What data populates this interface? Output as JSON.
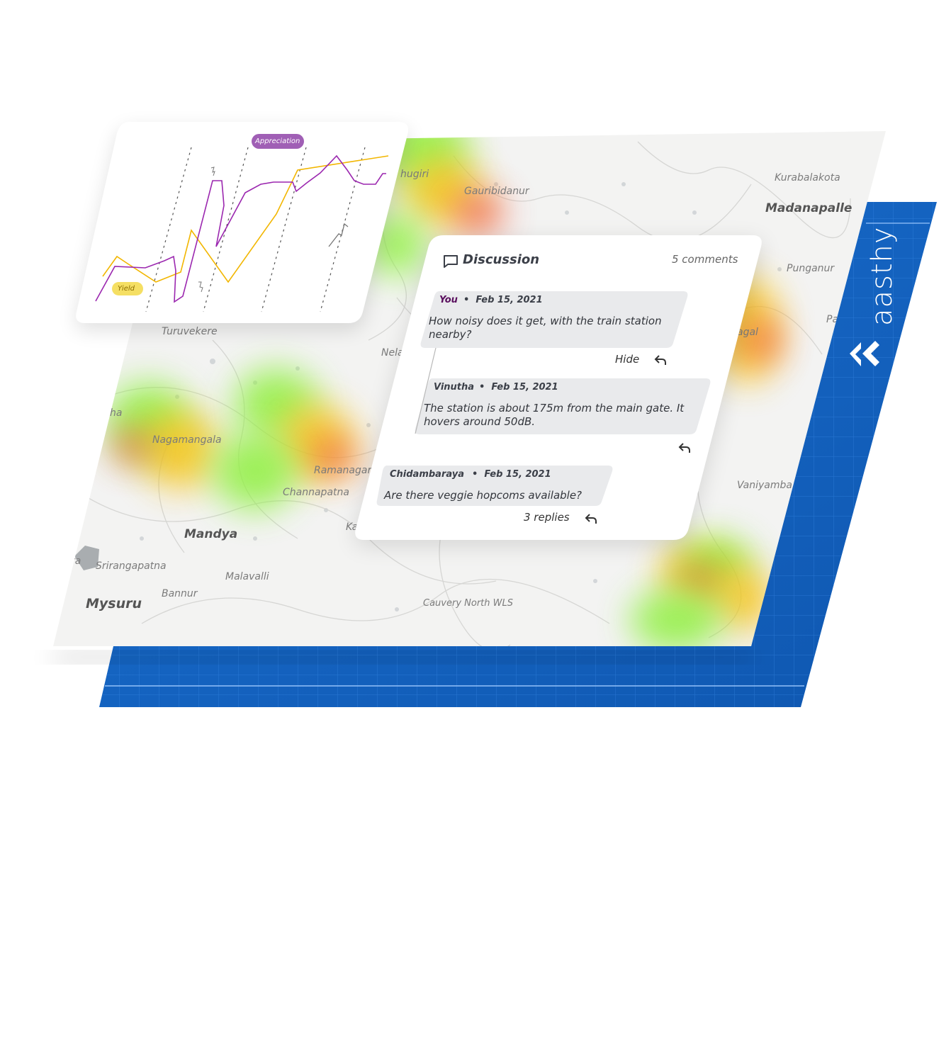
{
  "brand": {
    "name": "aasthy"
  },
  "map": {
    "labels": [
      {
        "text": "Gauribidanur",
        "cls": ""
      },
      {
        "text": "Kurabalakota",
        "cls": ""
      },
      {
        "text": "Madanapalle",
        "cls": "big"
      },
      {
        "text": "Punganur",
        "cls": ""
      },
      {
        "text": "Pa",
        "cls": ""
      },
      {
        "text": "agal",
        "cls": ""
      },
      {
        "text": "Turuvekere",
        "cls": ""
      },
      {
        "text": "Nela",
        "cls": ""
      },
      {
        "text": "Nagamangala",
        "cls": ""
      },
      {
        "text": "Ramanagar",
        "cls": ""
      },
      {
        "text": "Channapatna",
        "cls": ""
      },
      {
        "text": "Mandya",
        "cls": "big"
      },
      {
        "text": "Srirangapatna",
        "cls": ""
      },
      {
        "text": "Malavalli",
        "cls": ""
      },
      {
        "text": "Bannur",
        "cls": ""
      },
      {
        "text": "Mysuru",
        "cls": "big"
      },
      {
        "text": "Cauvery North WLS",
        "cls": ""
      },
      {
        "text": "Vaniyamba",
        "cls": ""
      },
      {
        "text": "hugiri",
        "cls": ""
      },
      {
        "text": "ha",
        "cls": ""
      },
      {
        "text": "ra",
        "cls": ""
      },
      {
        "text": "Ka",
        "cls": ""
      }
    ]
  },
  "chart_data": {
    "type": "line",
    "series": [
      {
        "name": "Appreciation",
        "color": "#9b27af"
      },
      {
        "name": "Yield",
        "color": "#f2b600"
      }
    ],
    "legend_tags": {
      "appreciation": "Appreciation",
      "yield": "Yield"
    }
  },
  "discussion": {
    "title": "Discussion",
    "count": "5 comments",
    "comments": [
      {
        "author": "You",
        "date": "Feb 15, 2021",
        "body": "How noisy does it get, with the train station nearby?",
        "action": "Hide"
      },
      {
        "author": "Vinutha",
        "date": "Feb 15, 2021",
        "body": "The station is about 175m from the main gate. It hovers around 50dB.",
        "action": ""
      },
      {
        "author": "Chidambaraya",
        "date": "Feb 15, 2021",
        "body": "Are there veggie hopcoms available?",
        "action": "3 replies"
      }
    ]
  },
  "colors": {
    "plate": "#1565c0",
    "appreciation": "#9b27af",
    "yield": "#f2b600"
  }
}
